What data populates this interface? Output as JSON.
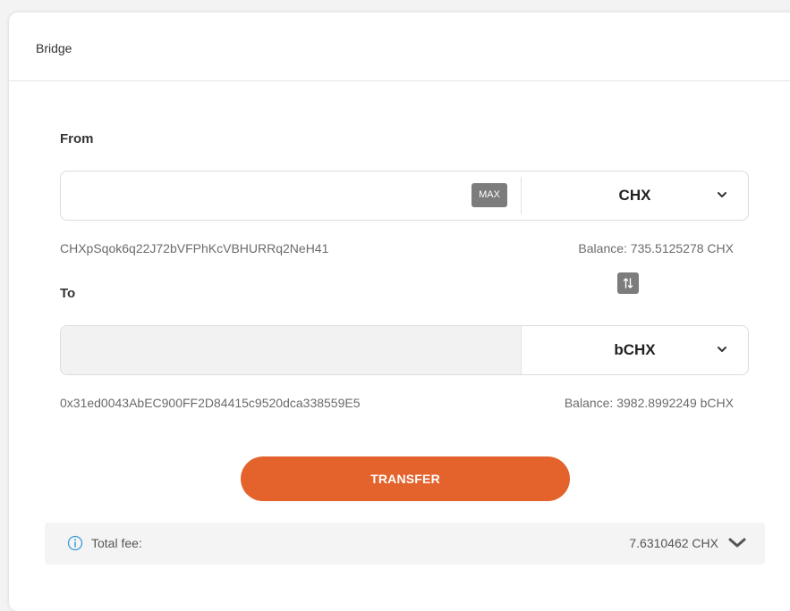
{
  "card": {
    "title": "Bridge"
  },
  "from": {
    "label": "From",
    "amount_value": "",
    "max_label": "MAX",
    "token": "CHX",
    "address": "CHXpSqok6q22J72bVFPhKcVBHURRq2NeH41",
    "balance": "Balance: 735.5125278 CHX"
  },
  "swap": {
    "icon": "swap-vertical-icon"
  },
  "to": {
    "label": "To",
    "amount_value": "",
    "token": "bCHX",
    "address": "0x31ed0043AbEC900FF2D84415c9520dca338559E5",
    "balance": "Balance: 3982.8992249 bCHX"
  },
  "transfer": {
    "label": "TRANSFER"
  },
  "fee": {
    "label": "Total fee:",
    "value": "7.6310462 CHX",
    "info_icon": "info-icon",
    "toggle_icon": "chevron-down-icon"
  },
  "colors": {
    "accent": "#e4622c",
    "info": "#3b9ad9",
    "muted_button": "#7c7c7c"
  }
}
